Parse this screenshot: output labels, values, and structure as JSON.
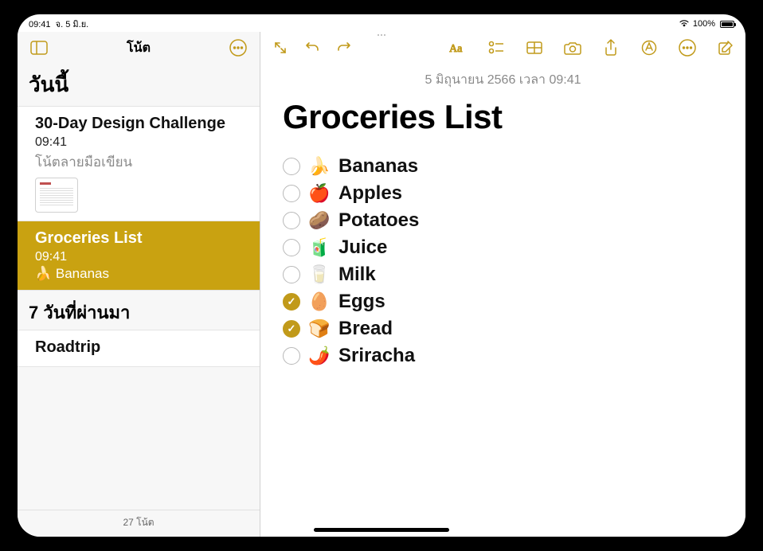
{
  "status": {
    "time": "09:41",
    "date": "จ. 5 มิ.ย.",
    "battery": "100%"
  },
  "sidebar": {
    "title": "โน้ต",
    "section1": "วันนี้",
    "section2": "7 วันที่ผ่านมา",
    "footer": "27 โน้ต",
    "items": [
      {
        "title": "30-Day Design Challenge",
        "time": "09:41",
        "sub": "โน้ตลายมือเขียน"
      },
      {
        "title": "Groceries List",
        "time": "09:41",
        "sub": "🍌 Bananas"
      },
      {
        "title": "Roadtrip",
        "time": "",
        "sub": ""
      }
    ]
  },
  "note": {
    "date": "5 มิถุนายน 2566 เวลา 09:41",
    "title": "Groceries List",
    "items": [
      {
        "emoji": "🍌",
        "text": "Bananas",
        "checked": false
      },
      {
        "emoji": "🍎",
        "text": "Apples",
        "checked": false
      },
      {
        "emoji": "🥔",
        "text": "Potatoes",
        "checked": false
      },
      {
        "emoji": "🧃",
        "text": "Juice",
        "checked": false
      },
      {
        "emoji": "🥛",
        "text": "Milk",
        "checked": false
      },
      {
        "emoji": "🥚",
        "text": "Eggs",
        "checked": true
      },
      {
        "emoji": "🍞",
        "text": "Bread",
        "checked": true
      },
      {
        "emoji": "🌶️",
        "text": "Sriracha",
        "checked": false
      }
    ]
  }
}
